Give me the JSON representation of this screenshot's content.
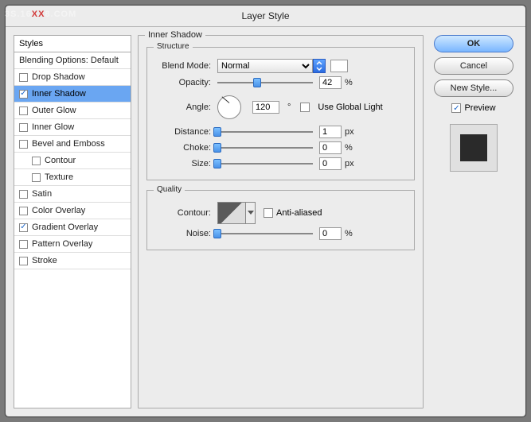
{
  "title": "Layer Style",
  "watermark1": "3S.16",
  "watermarkxx": "XX",
  "watermark2": "8.COM",
  "styles_title": "Styles",
  "styles_header": "Blending Options: Default",
  "styles": {
    "drop_shadow": "Drop Shadow",
    "inner_shadow": "Inner Shadow",
    "outer_glow": "Outer Glow",
    "inner_glow": "Inner Glow",
    "bevel": "Bevel and Emboss",
    "contour": "Contour",
    "texture": "Texture",
    "satin": "Satin",
    "color_overlay": "Color Overlay",
    "gradient_overlay": "Gradient Overlay",
    "pattern_overlay": "Pattern Overlay",
    "stroke": "Stroke"
  },
  "panel_title": "Inner Shadow",
  "structure_title": "Structure",
  "quality_title": "Quality",
  "labels": {
    "blend_mode": "Blend Mode:",
    "opacity": "Opacity:",
    "angle": "Angle:",
    "global": "Use Global Light",
    "distance": "Distance:",
    "choke": "Choke:",
    "size": "Size:",
    "contour": "Contour:",
    "anti": "Anti-aliased",
    "noise": "Noise:"
  },
  "values": {
    "blend_mode": "Normal",
    "opacity": "42",
    "angle": "120",
    "distance": "1",
    "choke": "0",
    "size": "0",
    "noise": "0"
  },
  "units": {
    "percent": "%",
    "degree": "°",
    "px": "px"
  },
  "buttons": {
    "ok": "OK",
    "cancel": "Cancel",
    "new_style": "New Style..."
  },
  "preview_label": "Preview"
}
